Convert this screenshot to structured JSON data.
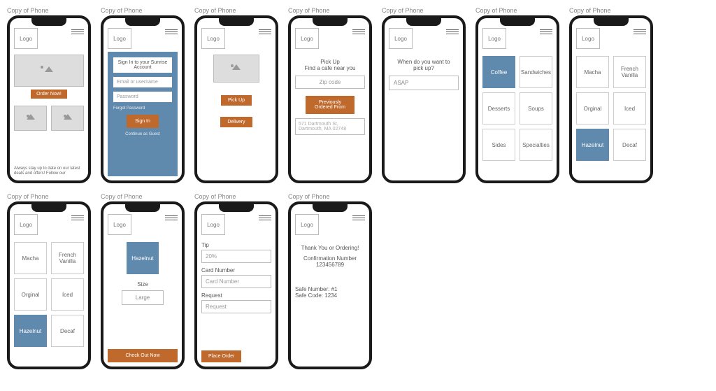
{
  "frame_title": "Copy of Phone",
  "logo": "Logo",
  "s1": {
    "order_now": "Order Now!",
    "footer": "Always stay up to date on our latest deals and offers! Follow our"
  },
  "s2": {
    "title": "Sign In to your Sunrise Account",
    "email_ph": "Email or username",
    "pass_ph": "Password",
    "forgot": "Forgot Password",
    "signin": "Sign In",
    "guest": "Continue as Guest"
  },
  "s3": {
    "pickup": "Pick Up",
    "delivery": "Delivery"
  },
  "s4": {
    "heading1": "Pick Up",
    "heading2": "Find a cafe near you",
    "zip_ph": "Zip code",
    "prev": "Previously Ordered From",
    "addr": "571 Dartmouth St, Dartmouth, MA 02748"
  },
  "s5": {
    "heading": "When do you want to pick up?",
    "asap": "ASAP"
  },
  "s6": {
    "coffee": "Coffee",
    "sandwiches": "Sandwiches",
    "desserts": "Desserts",
    "soups": "Soups",
    "sides": "Sides",
    "specialties": "Specialties"
  },
  "s7": {
    "macha": "Macha",
    "french": "French Vanilla",
    "orginal": "Orginal",
    "iced": "Iced",
    "hazelnut": "Hazelnut",
    "decaf": "Decaf"
  },
  "s8": {
    "hazelnut": "Hazelnut",
    "size_label": "Size",
    "size_value": "Large",
    "checkout": "Check Out Now"
  },
  "s9": {
    "tip_label": "Tip",
    "tip_ph": "20%",
    "card_label": "Card Number",
    "card_ph": "Card Number",
    "req_label": "Request",
    "req_ph": "Request",
    "place": "Place Order"
  },
  "s10": {
    "thanks": "Thank You or Ordering!",
    "conf_label": "Confirmation Number",
    "conf_num": "123456789",
    "safe_num": "Safe Number: #1",
    "safe_code": "Safe Code: 1234"
  }
}
